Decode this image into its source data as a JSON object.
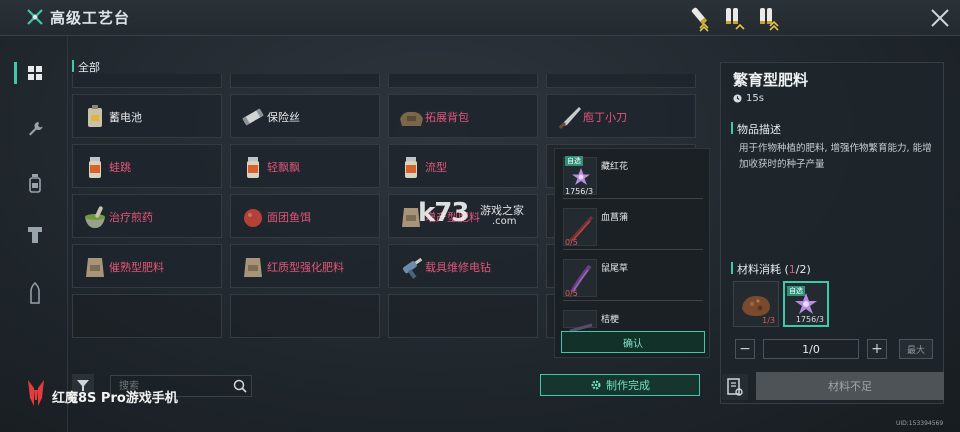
{
  "header": {
    "title": "高级工艺台"
  },
  "category": {
    "title": "全部"
  },
  "grid": {
    "rows": [
      [
        {
          "name": "",
          "icon": "gear-cut-icon",
          "red": false
        },
        {
          "name": "",
          "icon": "tool-cut-icon",
          "red": false
        },
        {
          "name": "",
          "icon": "pack-cut-icon",
          "red": false
        },
        {
          "name": "",
          "icon": "leather-cut-icon",
          "red": false
        }
      ],
      [
        {
          "name": "蓄电池",
          "icon": "battery-icon",
          "red": false
        },
        {
          "name": "保险丝",
          "icon": "fuse-icon",
          "red": false
        },
        {
          "name": "拓展背包",
          "icon": "backpack-icon",
          "red": true
        },
        {
          "name": "庖丁小刀",
          "icon": "knife-icon",
          "red": true
        }
      ],
      [
        {
          "name": "蛙跳",
          "icon": "injector-icon",
          "red": true
        },
        {
          "name": "轻飘飘",
          "icon": "injector-icon",
          "red": true
        },
        {
          "name": "流型",
          "icon": "injector-icon",
          "red": true
        },
        {
          "name": "",
          "icon": "",
          "red": false
        }
      ],
      [
        {
          "name": "治疗煎药",
          "icon": "mortar-icon",
          "red": true
        },
        {
          "name": "面团鱼饵",
          "icon": "bait-icon",
          "red": true
        },
        {
          "name": "增产型肥料",
          "icon": "fertilizer-bag-icon",
          "red": true
        },
        {
          "name": "",
          "icon": "",
          "red": false
        }
      ],
      [
        {
          "name": "催熟型肥料",
          "icon": "fertilizer-bag-icon",
          "red": true
        },
        {
          "name": "红质型强化肥料",
          "icon": "fertilizer-bag-icon",
          "red": true
        },
        {
          "name": "载具维修电钻",
          "icon": "drill-icon",
          "red": true
        },
        {
          "name": "",
          "icon": "",
          "red": false
        }
      ],
      [
        {
          "name": "",
          "icon": "",
          "red": false
        },
        {
          "name": "",
          "icon": "",
          "red": false
        },
        {
          "name": "",
          "icon": "",
          "red": false
        },
        {
          "name": "",
          "icon": "",
          "red": false
        }
      ]
    ]
  },
  "popup": {
    "items": [
      {
        "tag": "自选",
        "name": "藏红花",
        "count": "1756/3",
        "red": false,
        "icon": "saffron-icon"
      },
      {
        "tag": "",
        "name": "血菖蒲",
        "count": "0/5",
        "red": true,
        "icon": "calamus-icon"
      },
      {
        "tag": "",
        "name": "鼠尾草",
        "count": "0/5",
        "red": true,
        "icon": "sage-icon"
      },
      {
        "tag": "",
        "name": "桔梗",
        "count": "",
        "red": false,
        "icon": "balloonflower-icon"
      }
    ],
    "confirm_label": "确认"
  },
  "search": {
    "placeholder": "搜索"
  },
  "craft_complete_label": "制作完成",
  "detail": {
    "title": "繁育型肥料",
    "time": "15s",
    "desc_label": "物品描述",
    "description": "用于作物种植的肥料, 增强作物繁育能力, 能增加收获时的种子产量",
    "materials_label": "材料消耗 (",
    "materials_have": "1",
    "materials_total": "/2)",
    "materials": [
      {
        "count": "1/3",
        "red": true,
        "icon": "rock-ore-icon",
        "tag": ""
      },
      {
        "count": "1756/3",
        "red": false,
        "icon": "saffron-icon",
        "tag": "自选"
      }
    ],
    "quantity": "1/0",
    "max_label": "最大",
    "insufficient_label": "材料不足"
  },
  "brand": {
    "text": "红魔8S Pro游戏手机"
  },
  "watermark": {
    "big": "k73",
    "cn": "游戏之家",
    "com": ".com"
  },
  "uid": "UID:153394569",
  "colors": {
    "accent": "#3fc9a8",
    "red_text": "#e0557a",
    "bg": "#20272d"
  }
}
